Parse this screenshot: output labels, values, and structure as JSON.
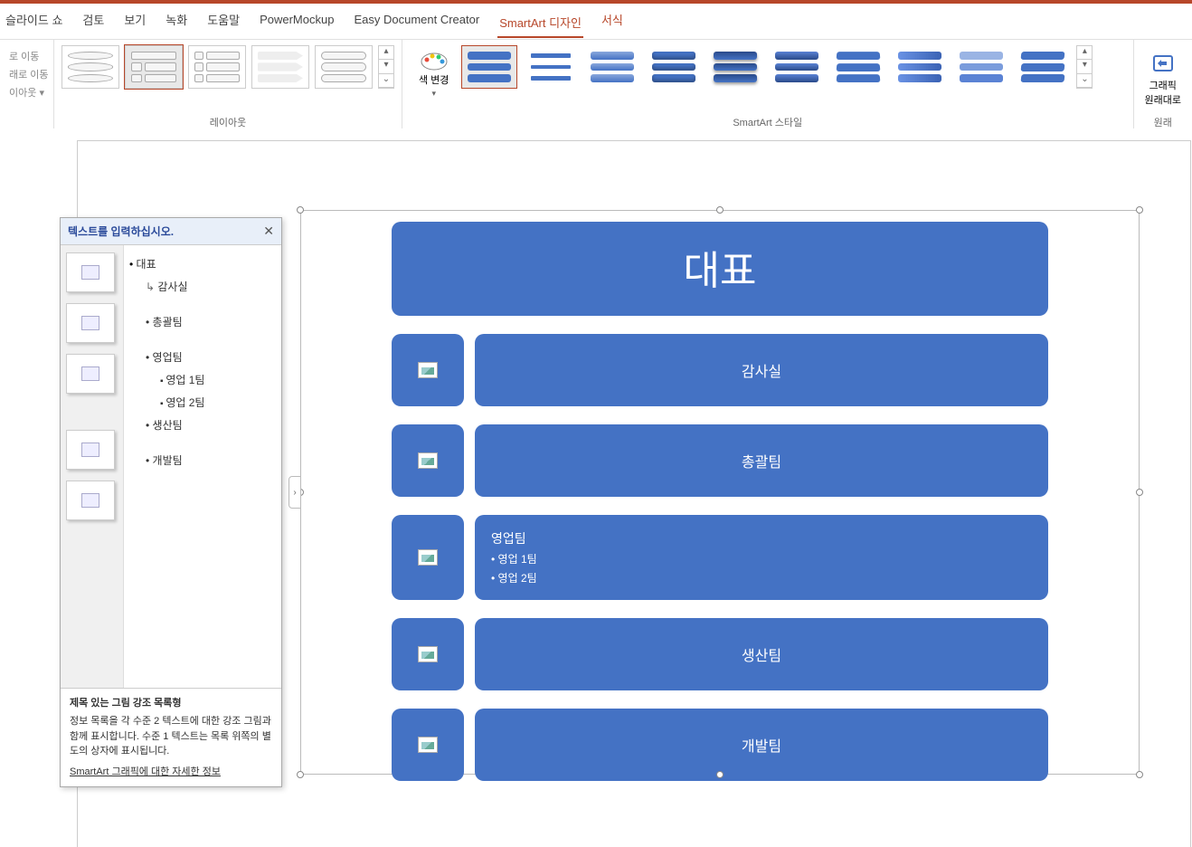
{
  "tabs": {
    "slideshow": "슬라이드 쇼",
    "review": "검토",
    "view": "보기",
    "record": "녹화",
    "help": "도움말",
    "powermockup": "PowerMockup",
    "edc": "Easy Document Creator",
    "smartart": "SmartArt 디자인",
    "format": "서식"
  },
  "ribbon": {
    "leftItems": {
      "a": "로 이동",
      "b": "래로 이동",
      "c": "이아웃",
      "dropdown": "▾"
    },
    "groupLabels": {
      "layout": "레이아웃",
      "styles": "SmartArt 스타일",
      "reset": "원래"
    },
    "changeColors": "색 변경",
    "resetGraphic": "그래픽\n원래대로"
  },
  "smartart": {
    "header": "대표",
    "rows": [
      {
        "type": "simple",
        "label": "감사실"
      },
      {
        "type": "simple",
        "label": "총괄팀"
      },
      {
        "type": "multi",
        "label": "영업팀",
        "subs": [
          "영업 1팀",
          "영업 2팀"
        ]
      },
      {
        "type": "simple",
        "label": "생산팀"
      },
      {
        "type": "simple",
        "label": "개발팀"
      }
    ]
  },
  "textPane": {
    "title": "텍스트를 입력하십시오.",
    "outline": [
      {
        "level": "l1",
        "text": "대표"
      },
      {
        "level": "l2 arrow",
        "text": "감사실"
      },
      {
        "level": "spacer"
      },
      {
        "level": "l2 bullet",
        "text": "총괄팀"
      },
      {
        "level": "spacer"
      },
      {
        "level": "l2 bullet",
        "text": "영업팀"
      },
      {
        "level": "l3",
        "text": "영업 1팀"
      },
      {
        "level": "l3",
        "text": "영업 2팀"
      },
      {
        "level": "l2 bullet",
        "text": "생산팀"
      },
      {
        "level": "spacer"
      },
      {
        "level": "l2 bullet",
        "text": "개발팀"
      }
    ],
    "footer": {
      "title": "제목 있는 그림 강조 목록형",
      "desc": "정보 목록을 각 수준 2 텍스트에 대한 강조 그림과 함께 표시합니다. 수준 1 텍스트는 목록 위쪽의 별도의 상자에 표시됩니다.",
      "link": "SmartArt 그래픽에 대한 자세한 정보"
    }
  }
}
